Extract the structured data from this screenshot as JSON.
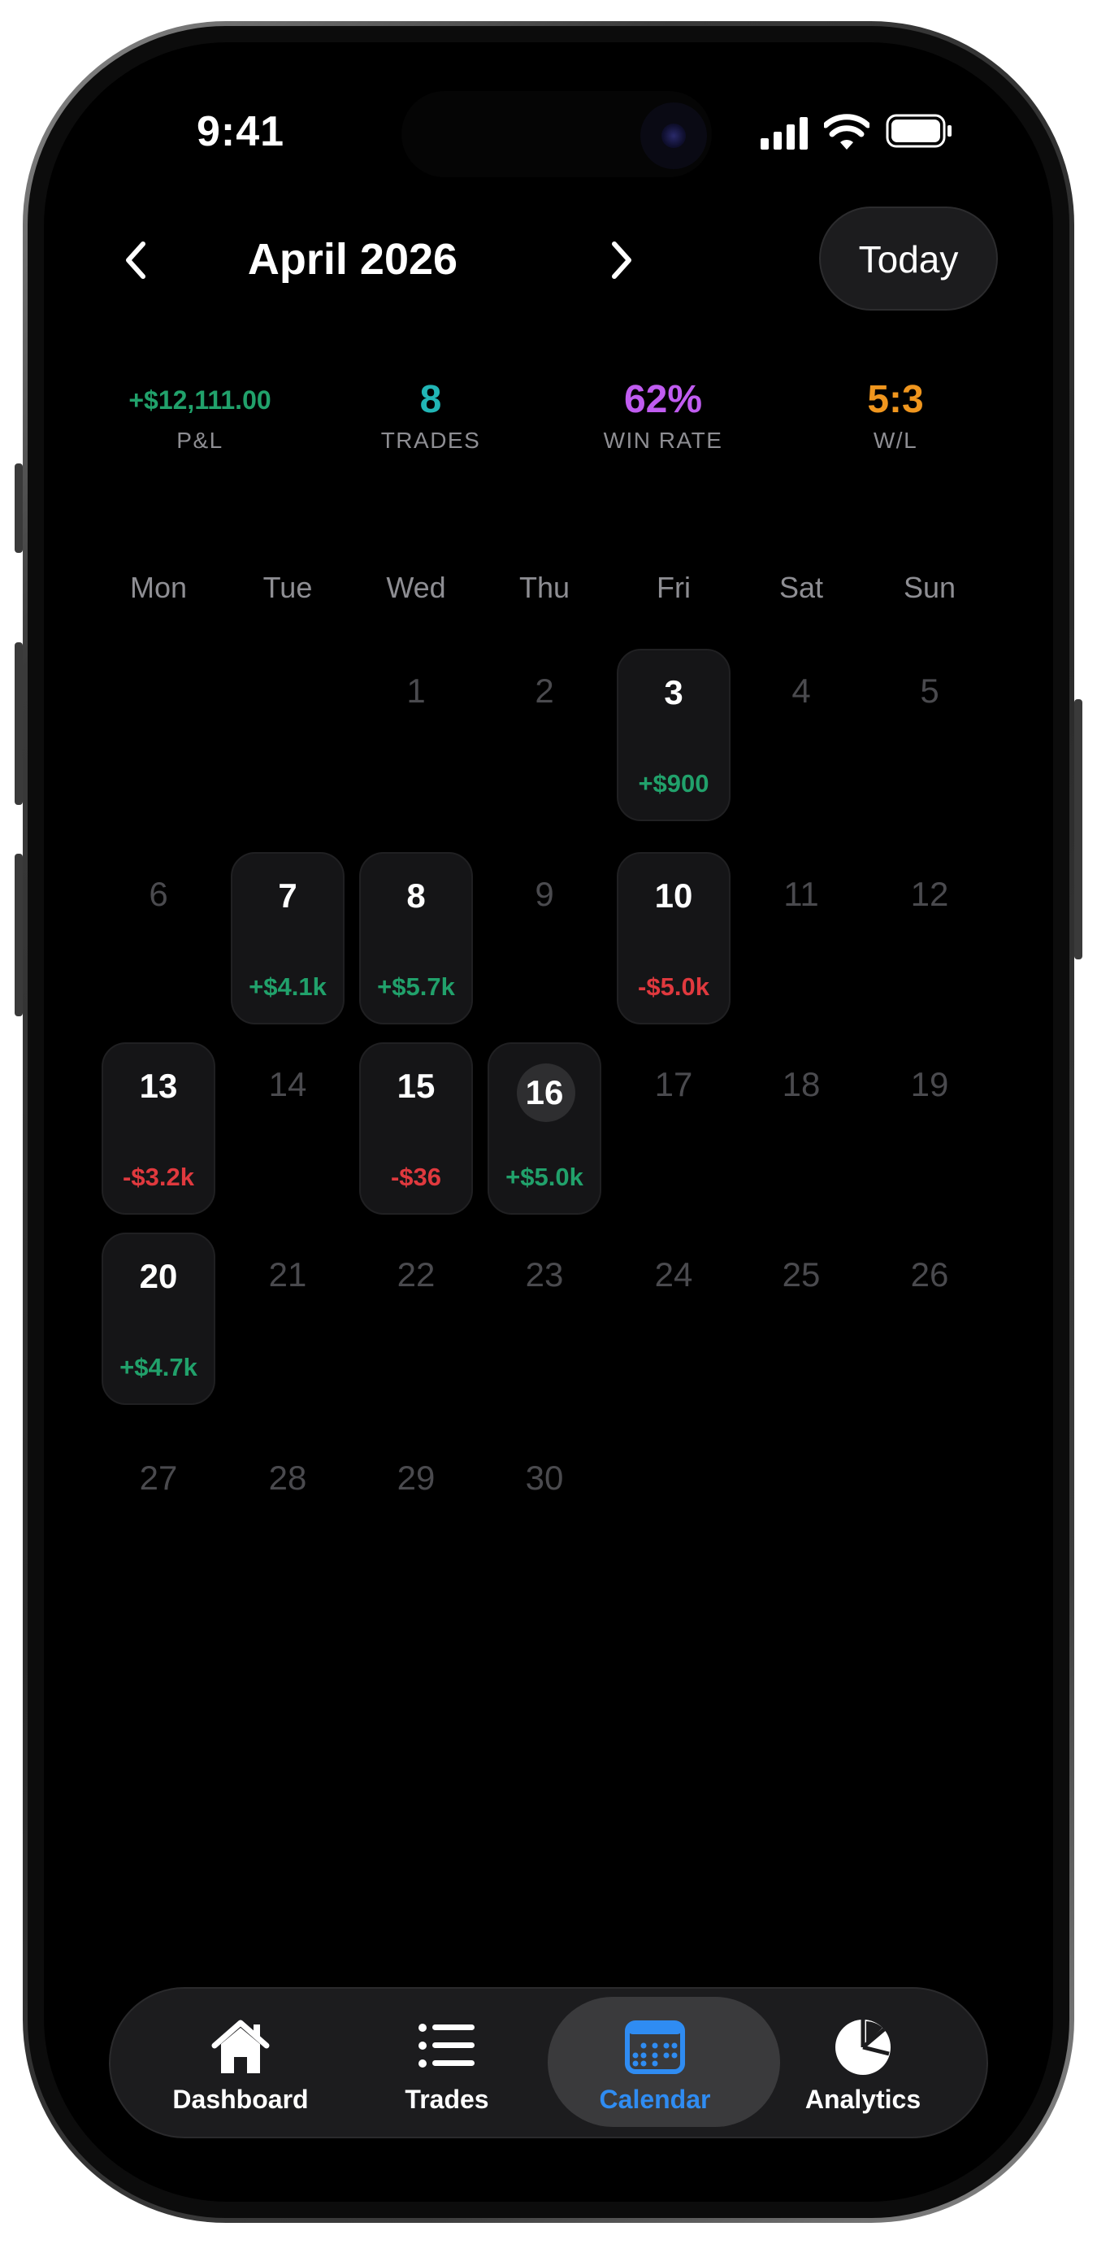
{
  "status_bar": {
    "time": "9:41"
  },
  "header": {
    "month": "April 2026",
    "today_label": "Today"
  },
  "stats": [
    {
      "value": "+$12,111.00",
      "label": "P&L",
      "color": "#21a16b"
    },
    {
      "value": "8",
      "label": "TRADES",
      "color": "#21b5b5"
    },
    {
      "value": "62%",
      "label": "WIN RATE",
      "color": "#c05cf0"
    },
    {
      "value": "5:3",
      "label": "W/L",
      "color": "#f0961e"
    }
  ],
  "weekdays": [
    "Mon",
    "Tue",
    "Wed",
    "Thu",
    "Fri",
    "Sat",
    "Sun"
  ],
  "colors": {
    "profit": "#21a16b",
    "loss": "#e0393e",
    "accent": "#2f8cf2"
  },
  "calendar": {
    "today": 16,
    "weeks": [
      [
        null,
        null,
        {
          "day": 1
        },
        {
          "day": 2
        },
        {
          "day": 3,
          "pnl": "+$900",
          "profit": true
        },
        {
          "day": 4
        },
        {
          "day": 5
        }
      ],
      [
        {
          "day": 6
        },
        {
          "day": 7,
          "pnl": "+$4.1k",
          "profit": true
        },
        {
          "day": 8,
          "pnl": "+$5.7k",
          "profit": true
        },
        {
          "day": 9
        },
        {
          "day": 10,
          "pnl": "-$5.0k",
          "profit": false
        },
        {
          "day": 11
        },
        {
          "day": 12
        }
      ],
      [
        {
          "day": 13,
          "pnl": "-$3.2k",
          "profit": false
        },
        {
          "day": 14
        },
        {
          "day": 15,
          "pnl": "-$36",
          "profit": false
        },
        {
          "day": 16,
          "pnl": "+$5.0k",
          "profit": true
        },
        {
          "day": 17
        },
        {
          "day": 18
        },
        {
          "day": 19
        }
      ],
      [
        {
          "day": 20,
          "pnl": "+$4.7k",
          "profit": true
        },
        {
          "day": 21
        },
        {
          "day": 22
        },
        {
          "day": 23
        },
        {
          "day": 24
        },
        {
          "day": 25
        },
        {
          "day": 26
        }
      ],
      [
        {
          "day": 27
        },
        {
          "day": 28
        },
        {
          "day": 29
        },
        {
          "day": 30
        },
        null,
        null,
        null
      ]
    ]
  },
  "tabbar": {
    "tabs": [
      {
        "label": "Dashboard",
        "icon": "house-icon",
        "selected": false
      },
      {
        "label": "Trades",
        "icon": "list-icon",
        "selected": false
      },
      {
        "label": "Calendar",
        "icon": "calendar-icon",
        "selected": true
      },
      {
        "label": "Analytics",
        "icon": "pie-chart-icon",
        "selected": false
      }
    ]
  }
}
